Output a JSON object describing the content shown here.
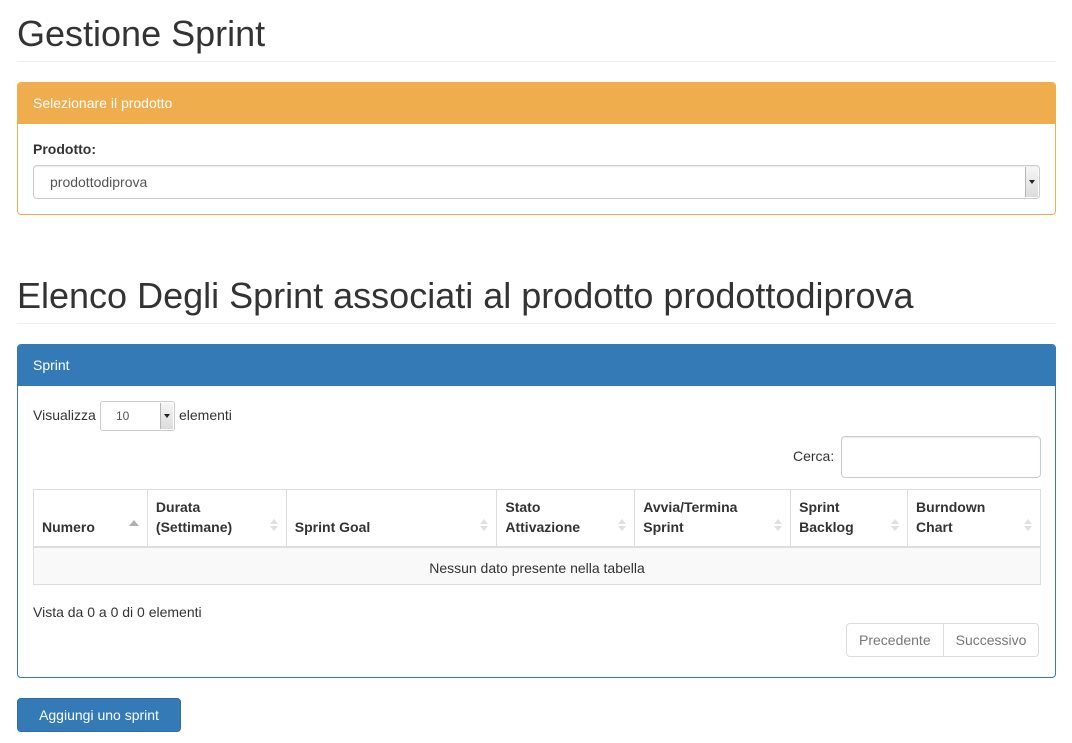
{
  "header": {
    "title": "Gestione Sprint"
  },
  "product_panel": {
    "heading": "Selezionare il prodotto",
    "label": "Prodotto:",
    "selected": "prodottodiprova"
  },
  "list_header": {
    "title": "Elenco Degli Sprint associati al prodotto prodottodiprova"
  },
  "sprint_panel": {
    "heading": "Sprint",
    "length_prefix": "Visualizza",
    "length_value": "10",
    "length_suffix": "elementi",
    "search_label": "Cerca:",
    "search_value": "",
    "columns": [
      {
        "line1": "Numero",
        "line2": ""
      },
      {
        "line1": "Durata",
        "line2": "(Settimane)"
      },
      {
        "line1": "Sprint Goal",
        "line2": ""
      },
      {
        "line1": "Stato",
        "line2": "Attivazione"
      },
      {
        "line1": "Avvia/Termina",
        "line2": "Sprint"
      },
      {
        "line1": "Sprint",
        "line2": "Backlog"
      },
      {
        "line1": "Burndown",
        "line2": "Chart"
      }
    ],
    "empty_message": "Nessun dato presente nella tabella",
    "info": "Vista da 0 a 0 di 0 elementi",
    "prev_label": "Precedente",
    "next_label": "Successivo"
  },
  "add_button": "Aggiungi uno sprint"
}
